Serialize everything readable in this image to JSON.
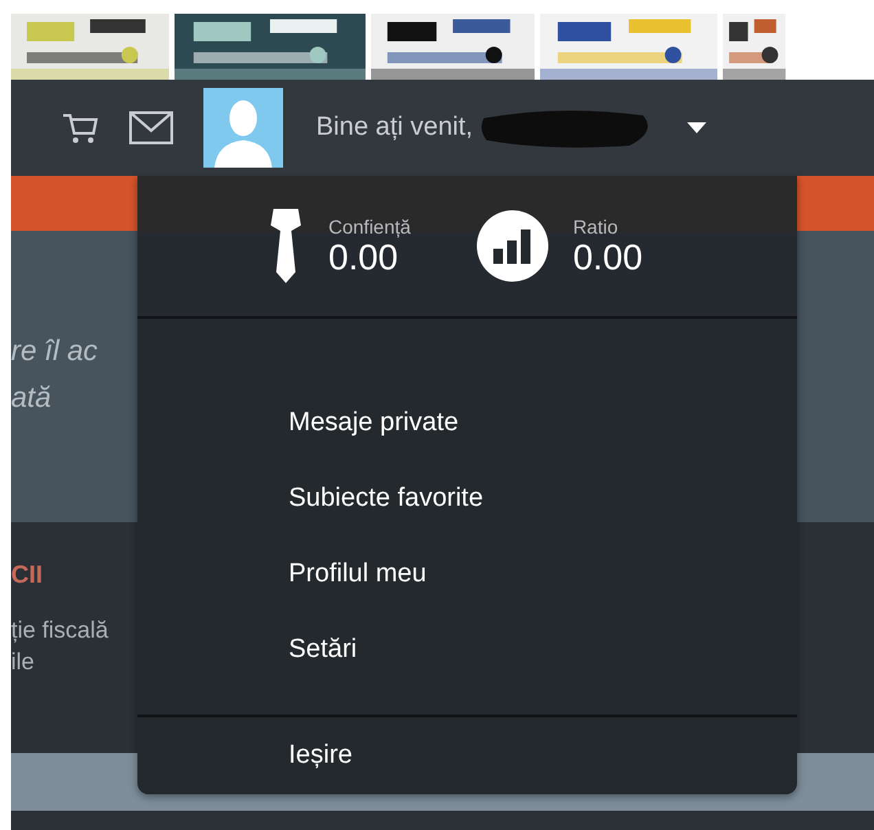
{
  "header": {
    "greeting": "Bine ați venit,",
    "name_redacted": true
  },
  "background": {
    "quote_lines": [
      "re îl ac",
      "ată"
    ],
    "section_title": "CII",
    "section_lines": [
      "ție fiscală",
      "ile"
    ]
  },
  "user_menu": {
    "stats": [
      {
        "kind": "tie",
        "label": "Confiență",
        "value": "0.00"
      },
      {
        "kind": "chart",
        "label": "Ratio",
        "value": "0.00"
      }
    ],
    "items": [
      "Mesaje private",
      "Subiecte favorite",
      "Profilul meu",
      "Setări"
    ],
    "exit": "Ieșire"
  }
}
